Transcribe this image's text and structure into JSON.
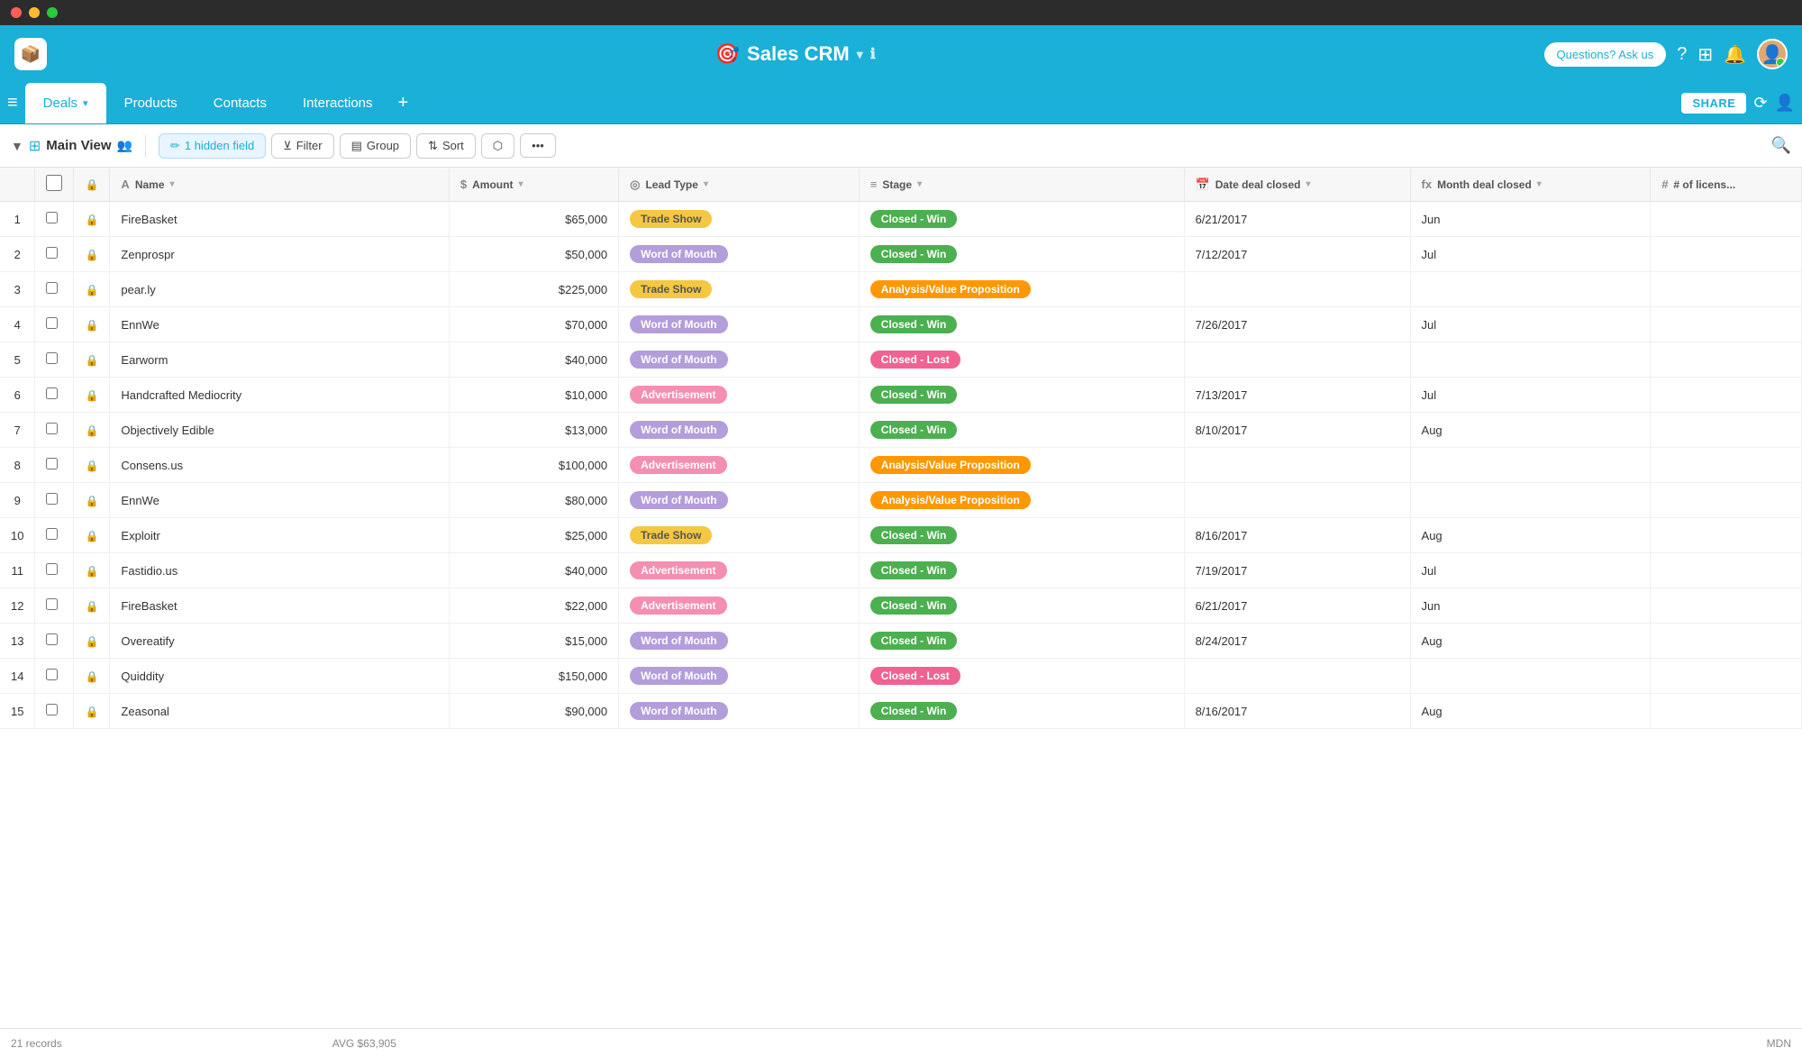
{
  "titleBar": {
    "trafficLights": [
      "red",
      "yellow",
      "green"
    ]
  },
  "appHeader": {
    "logoIcon": "📦",
    "title": "Sales CRM",
    "titleDropdownLabel": "▾",
    "infoIcon": "ℹ",
    "askUsLabel": "Questions? Ask us",
    "helpIcon": "?",
    "appsIcon": "⊞",
    "notifIcon": "🔔"
  },
  "navBar": {
    "menuIcon": "≡",
    "tabs": [
      {
        "label": "Deals",
        "active": true,
        "hasCaret": true
      },
      {
        "label": "Products",
        "active": false,
        "hasCaret": false
      },
      {
        "label": "Contacts",
        "active": false,
        "hasCaret": false
      },
      {
        "label": "Interactions",
        "active": false,
        "hasCaret": false
      }
    ],
    "addTabIcon": "+",
    "shareLabel": "SHARE",
    "historyIcon": "⟳",
    "usersIcon": "👤"
  },
  "toolbar": {
    "collapseIcon": "▼",
    "gridIcon": "⊞",
    "viewLabel": "Main View",
    "usersIcon": "👥",
    "hiddenFieldLabel": "1 hidden field",
    "filterLabel": "Filter",
    "groupLabel": "Group",
    "sortLabel": "Sort",
    "exportIcon": "⬡",
    "moreIcon": "•••",
    "searchIcon": "🔍"
  },
  "table": {
    "columns": [
      {
        "key": "row_num",
        "label": "",
        "icon": ""
      },
      {
        "key": "checkbox",
        "label": "",
        "icon": ""
      },
      {
        "key": "lock",
        "label": "",
        "icon": ""
      },
      {
        "key": "name",
        "label": "Name",
        "icon": "A"
      },
      {
        "key": "amount",
        "label": "Amount",
        "icon": "$"
      },
      {
        "key": "lead_type",
        "label": "Lead Type",
        "icon": "◎"
      },
      {
        "key": "stage",
        "label": "Stage",
        "icon": "≡"
      },
      {
        "key": "date_deal_closed",
        "label": "Date deal closed",
        "icon": "📅"
      },
      {
        "key": "month_deal_closed",
        "label": "Month deal closed",
        "icon": "fx"
      },
      {
        "key": "num_licenses",
        "label": "# of licens...",
        "icon": "#"
      }
    ],
    "rows": [
      {
        "num": 1,
        "name": "FireBasket",
        "amount": "$65,000",
        "lead_type": "Trade Show",
        "lead_type_class": "trade-show",
        "stage": "Closed - Win",
        "stage_class": "closed-win",
        "date": "6/21/2017",
        "month": "Jun"
      },
      {
        "num": 2,
        "name": "Zenprospr",
        "amount": "$50,000",
        "lead_type": "Word of Mouth",
        "lead_type_class": "word-of-mouth",
        "stage": "Closed - Win",
        "stage_class": "closed-win",
        "date": "7/12/2017",
        "month": "Jul"
      },
      {
        "num": 3,
        "name": "pear.ly",
        "amount": "$225,000",
        "lead_type": "Trade Show",
        "lead_type_class": "trade-show",
        "stage": "Analysis/Value Proposition",
        "stage_class": "analysis",
        "date": "",
        "month": ""
      },
      {
        "num": 4,
        "name": "EnnWe",
        "amount": "$70,000",
        "lead_type": "Word of Mouth",
        "lead_type_class": "word-of-mouth",
        "stage": "Closed - Win",
        "stage_class": "closed-win",
        "date": "7/26/2017",
        "month": "Jul"
      },
      {
        "num": 5,
        "name": "Earworm",
        "amount": "$40,000",
        "lead_type": "Word of Mouth",
        "lead_type_class": "word-of-mouth",
        "stage": "Closed - Lost",
        "stage_class": "closed-lost",
        "date": "",
        "month": ""
      },
      {
        "num": 6,
        "name": "Handcrafted Mediocrity",
        "amount": "$10,000",
        "lead_type": "Advertisement",
        "lead_type_class": "advertisement",
        "stage": "Closed - Win",
        "stage_class": "closed-win",
        "date": "7/13/2017",
        "month": "Jul"
      },
      {
        "num": 7,
        "name": "Objectively Edible",
        "amount": "$13,000",
        "lead_type": "Word of Mouth",
        "lead_type_class": "word-of-mouth",
        "stage": "Closed - Win",
        "stage_class": "closed-win",
        "date": "8/10/2017",
        "month": "Aug"
      },
      {
        "num": 8,
        "name": "Consens.us",
        "amount": "$100,000",
        "lead_type": "Advertisement",
        "lead_type_class": "advertisement",
        "stage": "Analysis/Value Proposition",
        "stage_class": "analysis",
        "date": "",
        "month": ""
      },
      {
        "num": 9,
        "name": "EnnWe",
        "amount": "$80,000",
        "lead_type": "Word of Mouth",
        "lead_type_class": "word-of-mouth",
        "stage": "Analysis/Value Proposition",
        "stage_class": "analysis",
        "date": "",
        "month": ""
      },
      {
        "num": 10,
        "name": "Exploitr",
        "amount": "$25,000",
        "lead_type": "Trade Show",
        "lead_type_class": "trade-show",
        "stage": "Closed - Win",
        "stage_class": "closed-win",
        "date": "8/16/2017",
        "month": "Aug"
      },
      {
        "num": 11,
        "name": "Fastidio.us",
        "amount": "$40,000",
        "lead_type": "Advertisement",
        "lead_type_class": "advertisement",
        "stage": "Closed - Win",
        "stage_class": "closed-win",
        "date": "7/19/2017",
        "month": "Jul"
      },
      {
        "num": 12,
        "name": "FireBasket",
        "amount": "$22,000",
        "lead_type": "Advertisement",
        "lead_type_class": "advertisement",
        "stage": "Closed - Win",
        "stage_class": "closed-win",
        "date": "6/21/2017",
        "month": "Jun"
      },
      {
        "num": 13,
        "name": "Overeatify",
        "amount": "$15,000",
        "lead_type": "Word of Mouth",
        "lead_type_class": "word-of-mouth",
        "stage": "Closed - Win",
        "stage_class": "closed-win",
        "date": "8/24/2017",
        "month": "Aug"
      },
      {
        "num": 14,
        "name": "Quiddity",
        "amount": "$150,000",
        "lead_type": "Word of Mouth",
        "lead_type_class": "word-of-mouth",
        "stage": "Closed - Lost",
        "stage_class": "closed-lost",
        "date": "",
        "month": ""
      },
      {
        "num": 15,
        "name": "Zeasonal",
        "amount": "$90,000",
        "lead_type": "Word of Mouth",
        "lead_type_class": "word-of-mouth",
        "stage": "Closed - Win",
        "stage_class": "closed-win",
        "date": "8/16/2017",
        "month": "Aug"
      }
    ]
  },
  "statusBar": {
    "recordCount": "21 records",
    "avgLabel": "AVG $63,905",
    "rightLabel": "MDN"
  }
}
